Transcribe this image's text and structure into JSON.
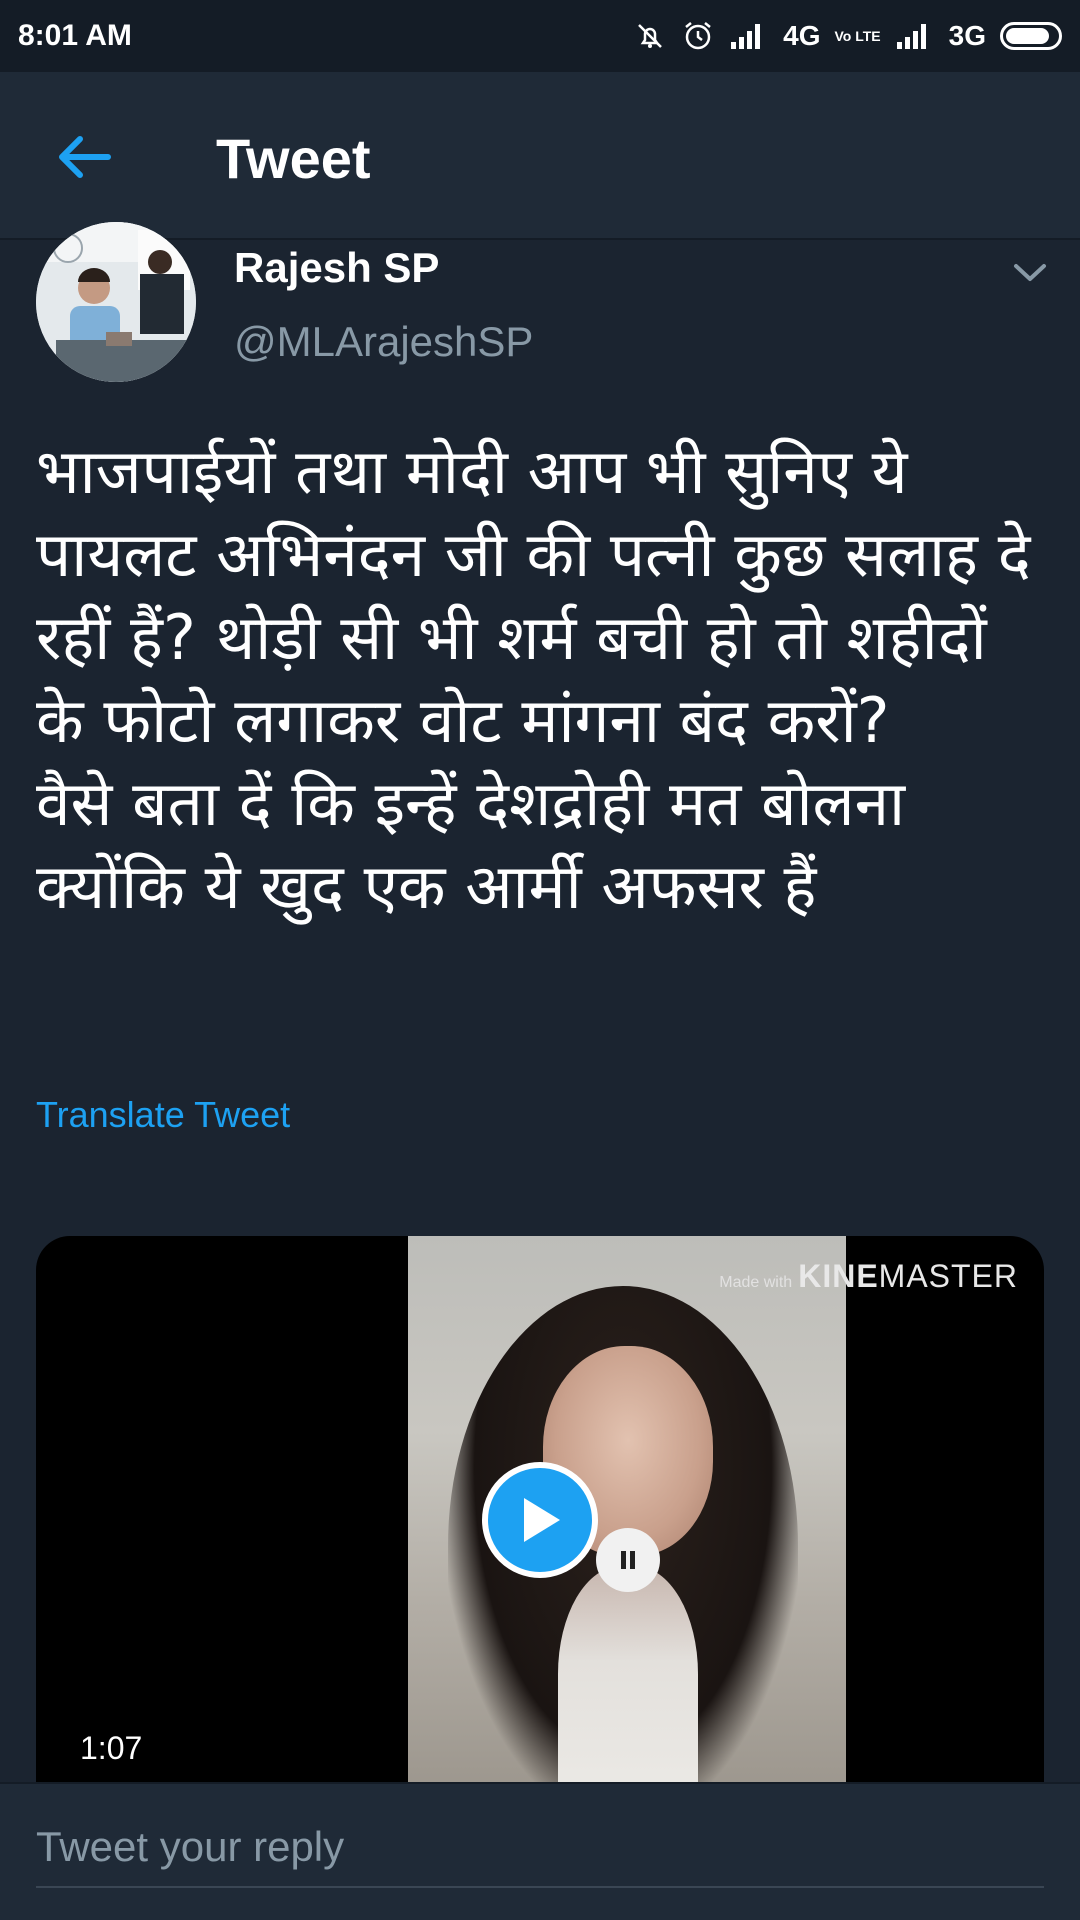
{
  "status_bar": {
    "time": "8:01 AM",
    "network_1": "4G",
    "volte": "Vo LTE",
    "network_2": "3G",
    "battery_level": 0.85
  },
  "header": {
    "title": "Tweet"
  },
  "tweet": {
    "author_name": "Rajesh SP",
    "author_handle": "@MLArajeshSP",
    "text": "भाजपाईयों तथा मोदी आप भी सुनिए ये पायलट अभिनंदन जी की पत्नी कुछ सलाह दे रहीं हैं? थोड़ी सी भी शर्म बची हो तो शहीदों के फोटो लगाकर वोट मांगना बंद करों?\nवैसे बता दें कि इन्हें देशद्रोही मत बोलना क्योंकि ये खुद एक आर्मी अफसर हैं",
    "translate_label": "Translate Tweet"
  },
  "video": {
    "watermark_prefix": "Made with",
    "watermark_bold": "KINE",
    "watermark_rest": "MASTER",
    "duration": "1:07"
  },
  "reply": {
    "placeholder": "Tweet your reply"
  },
  "colors": {
    "background": "#1b2430",
    "header": "#1f2a37",
    "accent": "#1da1f2",
    "secondary_text": "#8899a6"
  }
}
